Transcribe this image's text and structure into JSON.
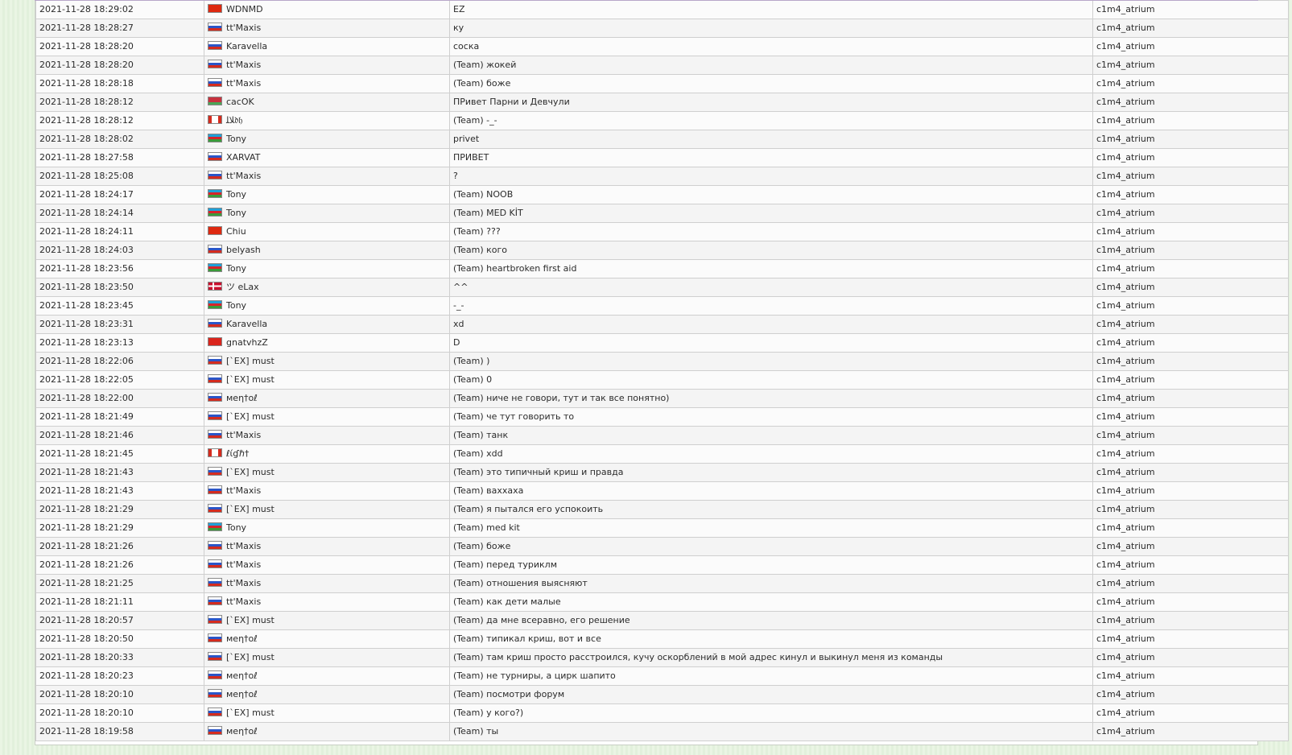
{
  "chat_log": {
    "rows": [
      {
        "time": "2021-11-28 18:29:02",
        "country": "cn",
        "name": "WDNMD",
        "message": "EZ",
        "map": "c1m4_atrium"
      },
      {
        "time": "2021-11-28 18:28:27",
        "country": "ru",
        "name": "tt'Maxis",
        "message": "ку",
        "map": "c1m4_atrium"
      },
      {
        "time": "2021-11-28 18:28:20",
        "country": "ru",
        "name": "Karavella",
        "message": "соска",
        "map": "c1m4_atrium"
      },
      {
        "time": "2021-11-28 18:28:20",
        "country": "ru",
        "name": "tt'Maxis",
        "message": "(Team) жокей",
        "map": "c1m4_atrium"
      },
      {
        "time": "2021-11-28 18:28:18",
        "country": "ru",
        "name": "tt'Maxis",
        "message": "(Team) боже",
        "map": "c1m4_atrium"
      },
      {
        "time": "2021-11-28 18:28:12",
        "country": "by",
        "name": "cacOK",
        "message": "ПРивет Парни и Девчули",
        "map": "c1m4_atrium"
      },
      {
        "time": "2021-11-28 18:28:12",
        "country": "ca",
        "name": "ﻼﻠ𝔡𝔥",
        "message": "(Team) -_-",
        "map": "c1m4_atrium"
      },
      {
        "time": "2021-11-28 18:28:02",
        "country": "az",
        "name": "Tony",
        "message": "privet",
        "map": "c1m4_atrium"
      },
      {
        "time": "2021-11-28 18:27:58",
        "country": "ru",
        "name": "XARVAT",
        "message": "ПРИВЕТ",
        "map": "c1m4_atrium"
      },
      {
        "time": "2021-11-28 18:25:08",
        "country": "ru",
        "name": "tt'Maxis",
        "message": "?",
        "map": "c1m4_atrium"
      },
      {
        "time": "2021-11-28 18:24:17",
        "country": "az",
        "name": "Tony",
        "message": "(Team) NOOB",
        "map": "c1m4_atrium"
      },
      {
        "time": "2021-11-28 18:24:14",
        "country": "az",
        "name": "Tony",
        "message": "(Team) MED KİT",
        "map": "c1m4_atrium"
      },
      {
        "time": "2021-11-28 18:24:11",
        "country": "cn",
        "name": "Chiu",
        "message": "(Team) ???",
        "map": "c1m4_atrium"
      },
      {
        "time": "2021-11-28 18:24:03",
        "country": "ru",
        "name": "belyash",
        "message": "(Team) кого",
        "map": "c1m4_atrium"
      },
      {
        "time": "2021-11-28 18:23:56",
        "country": "az",
        "name": "Tony",
        "message": "(Team) heartbroken first aid",
        "map": "c1m4_atrium"
      },
      {
        "time": "2021-11-28 18:23:50",
        "country": "dk",
        "name": "ツ eLax",
        "message": "^^",
        "map": "c1m4_atrium"
      },
      {
        "time": "2021-11-28 18:23:45",
        "country": "az",
        "name": "Tony",
        "message": "-_-",
        "map": "c1m4_atrium"
      },
      {
        "time": "2021-11-28 18:23:31",
        "country": "ru",
        "name": "Karavella",
        "message": "xd",
        "map": "c1m4_atrium"
      },
      {
        "time": "2021-11-28 18:23:13",
        "country": "vn",
        "name": "gnatvhzZ",
        "message": "D",
        "map": "c1m4_atrium"
      },
      {
        "time": "2021-11-28 18:22:06",
        "country": "ru",
        "name": "[`EX] must",
        "message": "(Team) )",
        "map": "c1m4_atrium"
      },
      {
        "time": "2021-11-28 18:22:05",
        "country": "ru",
        "name": "[`EX] must",
        "message": "(Team) 0",
        "map": "c1m4_atrium"
      },
      {
        "time": "2021-11-28 18:22:00",
        "country": "ru",
        "name": "мeη†oℓ",
        "message": "(Team) ниче не говори, тут и так все понятно)",
        "map": "c1m4_atrium"
      },
      {
        "time": "2021-11-28 18:21:49",
        "country": "ru",
        "name": "[`EX] must",
        "message": "(Team) че тут говорить то",
        "map": "c1m4_atrium"
      },
      {
        "time": "2021-11-28 18:21:46",
        "country": "ru",
        "name": "tt'Maxis",
        "message": "(Team) танк",
        "map": "c1m4_atrium"
      },
      {
        "time": "2021-11-28 18:21:45",
        "country": "ca",
        "name": "ℓίɠℏ†",
        "message": "(Team) xdd",
        "map": "c1m4_atrium"
      },
      {
        "time": "2021-11-28 18:21:43",
        "country": "ru",
        "name": "[`EX] must",
        "message": "(Team) это типичный криш и правда",
        "map": "c1m4_atrium"
      },
      {
        "time": "2021-11-28 18:21:43",
        "country": "ru",
        "name": "tt'Maxis",
        "message": "(Team) ваххаха",
        "map": "c1m4_atrium"
      },
      {
        "time": "2021-11-28 18:21:29",
        "country": "ru",
        "name": "[`EX] must",
        "message": "(Team) я пытался его успокоить",
        "map": "c1m4_atrium"
      },
      {
        "time": "2021-11-28 18:21:29",
        "country": "az",
        "name": "Tony",
        "message": "(Team) med kit",
        "map": "c1m4_atrium"
      },
      {
        "time": "2021-11-28 18:21:26",
        "country": "ru",
        "name": "tt'Maxis",
        "message": "(Team) боже",
        "map": "c1m4_atrium"
      },
      {
        "time": "2021-11-28 18:21:26",
        "country": "ru",
        "name": "tt'Maxis",
        "message": "(Team) перед туриклм",
        "map": "c1m4_atrium"
      },
      {
        "time": "2021-11-28 18:21:25",
        "country": "ru",
        "name": "tt'Maxis",
        "message": "(Team) отношения выясняют",
        "map": "c1m4_atrium"
      },
      {
        "time": "2021-11-28 18:21:11",
        "country": "ru",
        "name": "tt'Maxis",
        "message": "(Team) как дети малые",
        "map": "c1m4_atrium"
      },
      {
        "time": "2021-11-28 18:20:57",
        "country": "ru",
        "name": "[`EX] must",
        "message": "(Team) да мне всеравно, его решение",
        "map": "c1m4_atrium"
      },
      {
        "time": "2021-11-28 18:20:50",
        "country": "ru",
        "name": "мeη†oℓ",
        "message": "(Team) типикал криш, вот и все",
        "map": "c1m4_atrium"
      },
      {
        "time": "2021-11-28 18:20:33",
        "country": "ru",
        "name": "[`EX] must",
        "message": "(Team) там криш просто расстроился, кучу оскорблений в мой адрес кинул и выкинул меня из команды",
        "map": "c1m4_atrium"
      },
      {
        "time": "2021-11-28 18:20:23",
        "country": "ru",
        "name": "мeη†oℓ",
        "message": "(Team) не турниры, а цирк шапито",
        "map": "c1m4_atrium"
      },
      {
        "time": "2021-11-28 18:20:10",
        "country": "ru",
        "name": "мeη†oℓ",
        "message": "(Team) посмотри форум",
        "map": "c1m4_atrium"
      },
      {
        "time": "2021-11-28 18:20:10",
        "country": "ru",
        "name": "[`EX] must",
        "message": "(Team) у кого?)",
        "map": "c1m4_atrium"
      },
      {
        "time": "2021-11-28 18:19:58",
        "country": "ru",
        "name": "мeη†oℓ",
        "message": "(Team) ты",
        "map": "c1m4_atrium"
      }
    ]
  }
}
